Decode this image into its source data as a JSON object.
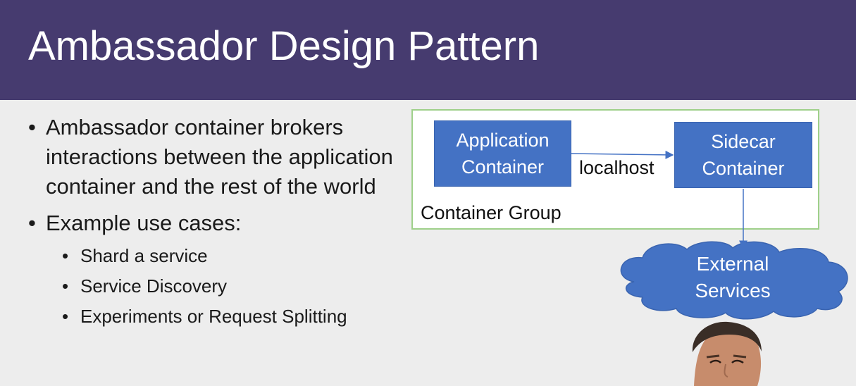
{
  "slide": {
    "title": "Ambassador Design Pattern"
  },
  "bullets": [
    {
      "text": "Ambassador container brokers interactions between the application container and the rest of the world"
    },
    {
      "text": "Example use cases:",
      "sub": [
        "Shard a service",
        "Service Discovery",
        "Experiments or Request Splitting"
      ]
    }
  ],
  "diagram": {
    "group_label": "Container Group",
    "application_node": {
      "line1": "Application",
      "line2": "Container"
    },
    "sidecar_node": {
      "line1": "Sidecar",
      "line2": "Container"
    },
    "edge_label": "localhost",
    "external_node": {
      "line1": "External",
      "line2": "Services"
    }
  },
  "colors": {
    "title_bar": "#463b6f",
    "node_fill": "#4472c4",
    "group_border": "#9fd08a",
    "background": "#ededed"
  },
  "icons": {
    "bullet": "•"
  }
}
